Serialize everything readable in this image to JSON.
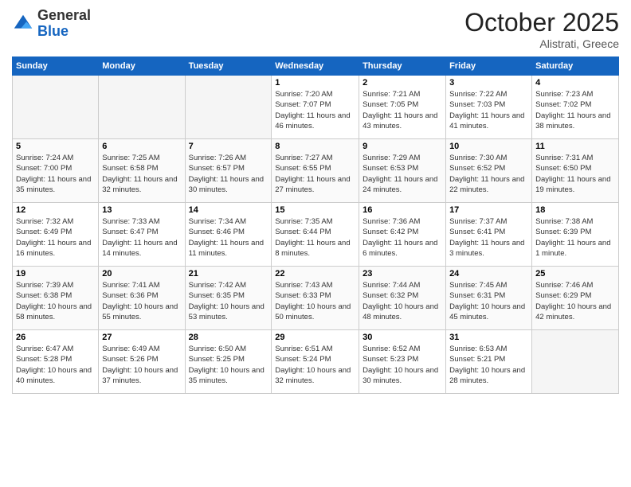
{
  "logo": {
    "general": "General",
    "blue": "Blue"
  },
  "title": "October 2025",
  "location": "Alistrati, Greece",
  "days_of_week": [
    "Sunday",
    "Monday",
    "Tuesday",
    "Wednesday",
    "Thursday",
    "Friday",
    "Saturday"
  ],
  "weeks": [
    [
      {
        "num": "",
        "info": ""
      },
      {
        "num": "",
        "info": ""
      },
      {
        "num": "",
        "info": ""
      },
      {
        "num": "1",
        "info": "Sunrise: 7:20 AM\nSunset: 7:07 PM\nDaylight: 11 hours and 46 minutes."
      },
      {
        "num": "2",
        "info": "Sunrise: 7:21 AM\nSunset: 7:05 PM\nDaylight: 11 hours and 43 minutes."
      },
      {
        "num": "3",
        "info": "Sunrise: 7:22 AM\nSunset: 7:03 PM\nDaylight: 11 hours and 41 minutes."
      },
      {
        "num": "4",
        "info": "Sunrise: 7:23 AM\nSunset: 7:02 PM\nDaylight: 11 hours and 38 minutes."
      }
    ],
    [
      {
        "num": "5",
        "info": "Sunrise: 7:24 AM\nSunset: 7:00 PM\nDaylight: 11 hours and 35 minutes."
      },
      {
        "num": "6",
        "info": "Sunrise: 7:25 AM\nSunset: 6:58 PM\nDaylight: 11 hours and 32 minutes."
      },
      {
        "num": "7",
        "info": "Sunrise: 7:26 AM\nSunset: 6:57 PM\nDaylight: 11 hours and 30 minutes."
      },
      {
        "num": "8",
        "info": "Sunrise: 7:27 AM\nSunset: 6:55 PM\nDaylight: 11 hours and 27 minutes."
      },
      {
        "num": "9",
        "info": "Sunrise: 7:29 AM\nSunset: 6:53 PM\nDaylight: 11 hours and 24 minutes."
      },
      {
        "num": "10",
        "info": "Sunrise: 7:30 AM\nSunset: 6:52 PM\nDaylight: 11 hours and 22 minutes."
      },
      {
        "num": "11",
        "info": "Sunrise: 7:31 AM\nSunset: 6:50 PM\nDaylight: 11 hours and 19 minutes."
      }
    ],
    [
      {
        "num": "12",
        "info": "Sunrise: 7:32 AM\nSunset: 6:49 PM\nDaylight: 11 hours and 16 minutes."
      },
      {
        "num": "13",
        "info": "Sunrise: 7:33 AM\nSunset: 6:47 PM\nDaylight: 11 hours and 14 minutes."
      },
      {
        "num": "14",
        "info": "Sunrise: 7:34 AM\nSunset: 6:46 PM\nDaylight: 11 hours and 11 minutes."
      },
      {
        "num": "15",
        "info": "Sunrise: 7:35 AM\nSunset: 6:44 PM\nDaylight: 11 hours and 8 minutes."
      },
      {
        "num": "16",
        "info": "Sunrise: 7:36 AM\nSunset: 6:42 PM\nDaylight: 11 hours and 6 minutes."
      },
      {
        "num": "17",
        "info": "Sunrise: 7:37 AM\nSunset: 6:41 PM\nDaylight: 11 hours and 3 minutes."
      },
      {
        "num": "18",
        "info": "Sunrise: 7:38 AM\nSunset: 6:39 PM\nDaylight: 11 hours and 1 minute."
      }
    ],
    [
      {
        "num": "19",
        "info": "Sunrise: 7:39 AM\nSunset: 6:38 PM\nDaylight: 10 hours and 58 minutes."
      },
      {
        "num": "20",
        "info": "Sunrise: 7:41 AM\nSunset: 6:36 PM\nDaylight: 10 hours and 55 minutes."
      },
      {
        "num": "21",
        "info": "Sunrise: 7:42 AM\nSunset: 6:35 PM\nDaylight: 10 hours and 53 minutes."
      },
      {
        "num": "22",
        "info": "Sunrise: 7:43 AM\nSunset: 6:33 PM\nDaylight: 10 hours and 50 minutes."
      },
      {
        "num": "23",
        "info": "Sunrise: 7:44 AM\nSunset: 6:32 PM\nDaylight: 10 hours and 48 minutes."
      },
      {
        "num": "24",
        "info": "Sunrise: 7:45 AM\nSunset: 6:31 PM\nDaylight: 10 hours and 45 minutes."
      },
      {
        "num": "25",
        "info": "Sunrise: 7:46 AM\nSunset: 6:29 PM\nDaylight: 10 hours and 42 minutes."
      }
    ],
    [
      {
        "num": "26",
        "info": "Sunrise: 6:47 AM\nSunset: 5:28 PM\nDaylight: 10 hours and 40 minutes."
      },
      {
        "num": "27",
        "info": "Sunrise: 6:49 AM\nSunset: 5:26 PM\nDaylight: 10 hours and 37 minutes."
      },
      {
        "num": "28",
        "info": "Sunrise: 6:50 AM\nSunset: 5:25 PM\nDaylight: 10 hours and 35 minutes."
      },
      {
        "num": "29",
        "info": "Sunrise: 6:51 AM\nSunset: 5:24 PM\nDaylight: 10 hours and 32 minutes."
      },
      {
        "num": "30",
        "info": "Sunrise: 6:52 AM\nSunset: 5:23 PM\nDaylight: 10 hours and 30 minutes."
      },
      {
        "num": "31",
        "info": "Sunrise: 6:53 AM\nSunset: 5:21 PM\nDaylight: 10 hours and 28 minutes."
      },
      {
        "num": "",
        "info": ""
      }
    ]
  ]
}
